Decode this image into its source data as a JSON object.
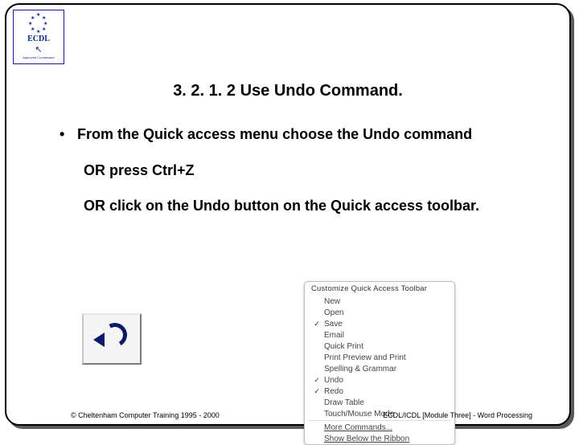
{
  "logo": {
    "text": "ECDL",
    "tagline": "Approved Courseware"
  },
  "title": "3. 2. 1. 2 Use Undo Command.",
  "bullet": {
    "pre": "From the ",
    "bold1": "Quick access",
    "mid": " menu choose the ",
    "bold2": "Undo",
    "post": " command"
  },
  "line2": {
    "pre": "OR press ",
    "bold": "Ctrl+Z"
  },
  "line3": {
    "pre": "OR click on the ",
    "bold": "Undo",
    "post": " button on the Quick access toolbar."
  },
  "menu": {
    "title": "Customize Quick Access Toolbar",
    "items": [
      {
        "checked": false,
        "label": "New"
      },
      {
        "checked": false,
        "label": "Open"
      },
      {
        "checked": true,
        "label": "Save"
      },
      {
        "checked": false,
        "label": "Email"
      },
      {
        "checked": false,
        "label": "Quick Print"
      },
      {
        "checked": false,
        "label": "Print Preview and Print"
      },
      {
        "checked": false,
        "label": "Spelling & Grammar"
      },
      {
        "checked": true,
        "label": "Undo"
      },
      {
        "checked": true,
        "label": "Redo"
      },
      {
        "checked": false,
        "label": "Draw Table"
      },
      {
        "checked": false,
        "label": "Touch/Mouse Mode"
      }
    ],
    "extra": [
      {
        "label": "More Commands..."
      },
      {
        "label": "Show Below the Ribbon"
      }
    ]
  },
  "footer": {
    "left": "© Cheltenham Computer Training 1995 - 2000",
    "right": "ECDL/ICDL [Module Three]  - Word Processing"
  }
}
